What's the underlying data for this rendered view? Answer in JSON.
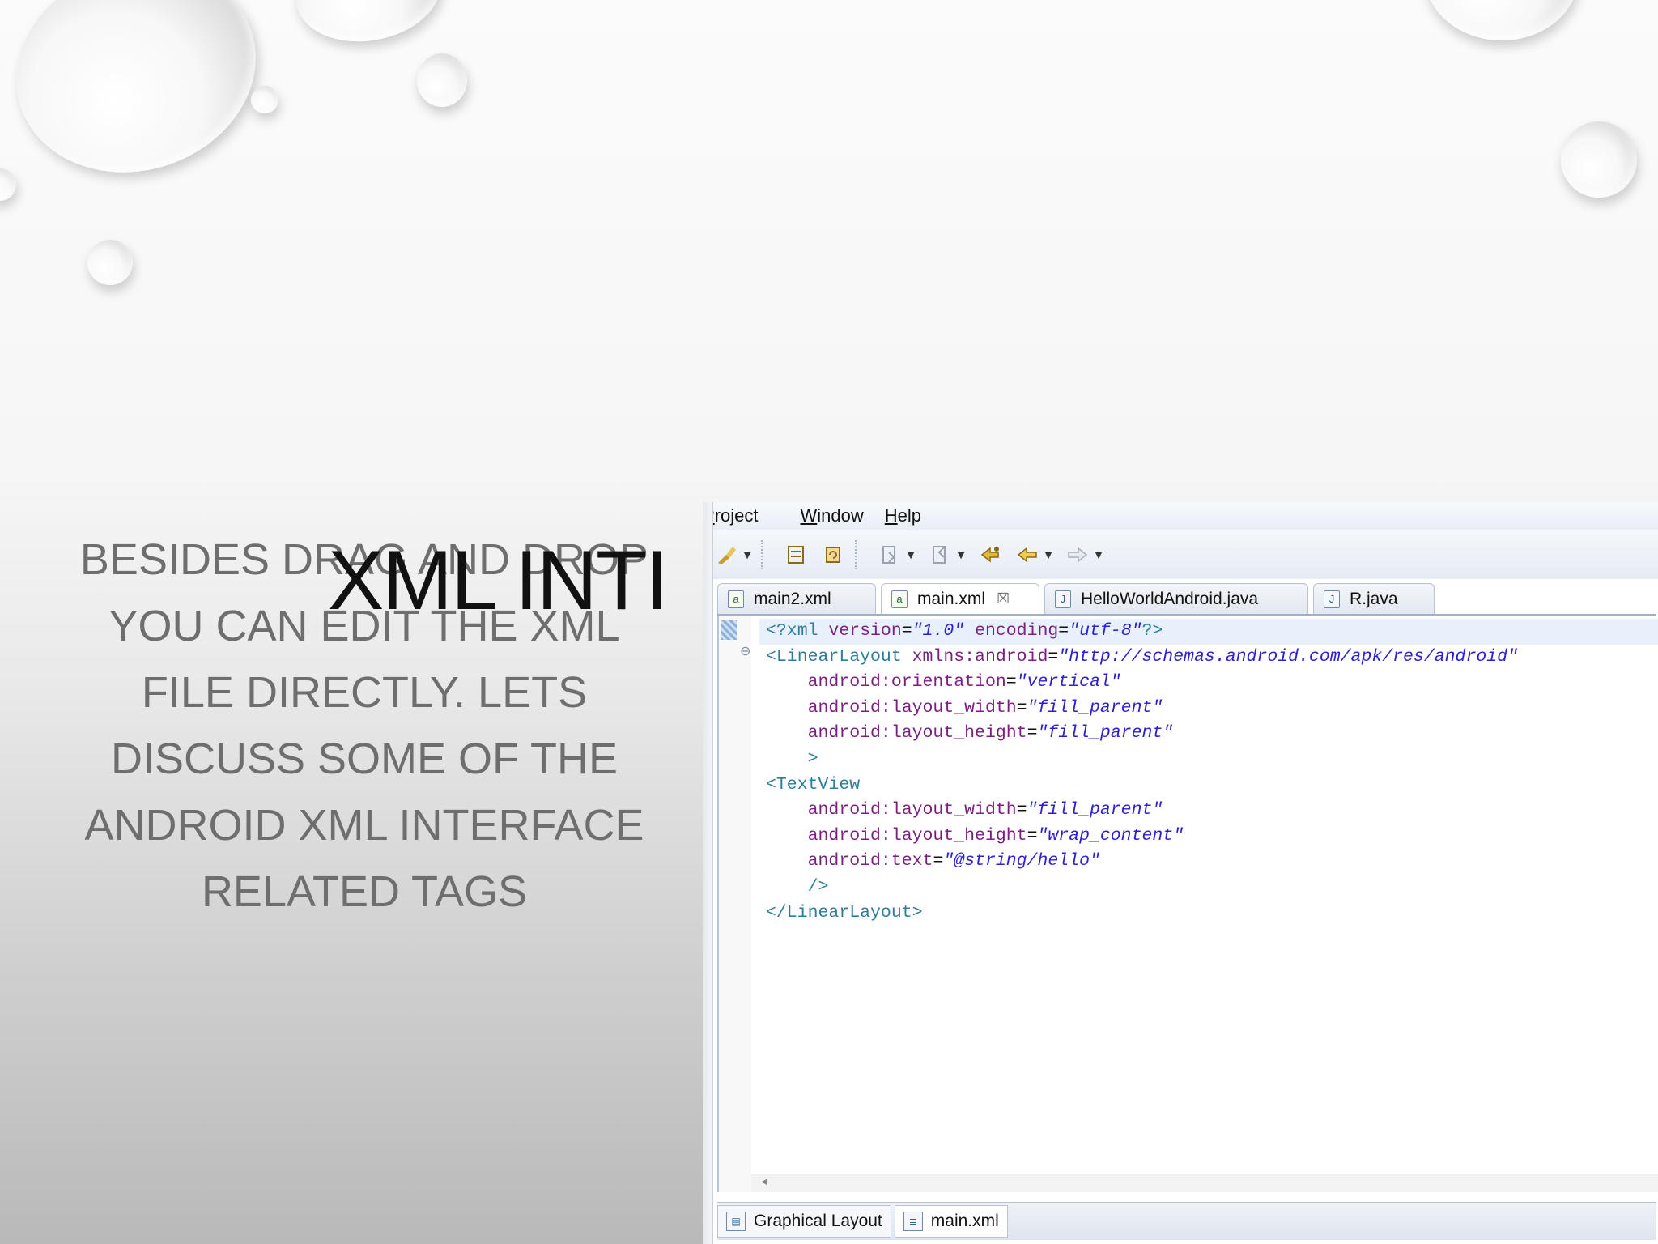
{
  "slide": {
    "title": "XML INTI",
    "body_lines": [
      "BESIDES DRAG AND DROP",
      "YOU CAN EDIT THE XML",
      "FILE DIRECTLY.  LETS",
      "DISCUSS SOME OF THE",
      "ANDROID XML INTERFACE",
      "RELATED TAGS"
    ]
  },
  "ide": {
    "menu": [
      {
        "label": "Project",
        "underline": "P"
      },
      {
        "label": "Window",
        "underline": "W"
      },
      {
        "label": "Help",
        "underline": "H"
      }
    ],
    "toolbar_icons": [
      "run-icon",
      "dropdown-icon",
      "new-layout-icon",
      "refresh-icon",
      "next-annotation-icon",
      "dropdown-icon",
      "prev-annotation-icon",
      "dropdown-icon",
      "last-edit-icon",
      "back-icon",
      "dropdown-icon",
      "forward-icon",
      "dropdown-icon"
    ],
    "tabs": [
      {
        "label": "main2.xml",
        "icon": "xml-file-icon",
        "active": false
      },
      {
        "label": "main.xml",
        "icon": "xml-file-icon",
        "active": true,
        "close": "☒"
      },
      {
        "label": "HelloWorldAndroid.java",
        "icon": "java-file-icon",
        "active": false
      },
      {
        "label": "R.java",
        "icon": "java-file-icon",
        "active": false
      }
    ],
    "code_lines": [
      "<?xml version=\"1.0\" encoding=\"utf-8\"?>",
      "<LinearLayout xmlns:android=\"http://schemas.android.com/apk/res/android\"",
      "    android:orientation=\"vertical\"",
      "    android:layout_width=\"fill_parent\"",
      "    android:layout_height=\"fill_parent\"",
      "    >",
      "<TextView",
      "    android:layout_width=\"fill_parent\"",
      "    android:layout_height=\"wrap_content\"",
      "    android:text=\"@string/hello\"",
      "    />",
      "</LinearLayout>"
    ],
    "bottom_tabs": [
      {
        "label": "Graphical Layout",
        "active": false
      },
      {
        "label": "main.xml",
        "active": true
      }
    ]
  },
  "colors": {
    "tag": "#2c7d9a",
    "attr": "#7a1f7f",
    "value": "#2a1fd6"
  }
}
